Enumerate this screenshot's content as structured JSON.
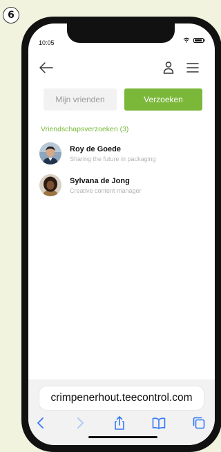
{
  "step": {
    "number": "6"
  },
  "status_bar": {
    "time": "10:05",
    "icons": [
      "wifi-icon",
      "battery-icon"
    ]
  },
  "nav": {
    "icons": [
      "back-arrow-icon",
      "user-icon",
      "hamburger-menu-icon"
    ]
  },
  "tabs": [
    {
      "label": "Mijn vrienden",
      "active": false
    },
    {
      "label": "Verzoeken",
      "active": true
    }
  ],
  "requests": {
    "title": "Vriendschapsverzoeken (3)",
    "items": [
      {
        "name": "Roy de Goede",
        "subtitle": "Sharing the future in packaging"
      },
      {
        "name": "Sylvana de Jong",
        "subtitle": "Creative content manager"
      }
    ]
  },
  "browser": {
    "url": "crimpenerhout.teecontrol.com",
    "toolbar_icons": [
      "back-icon",
      "forward-icon",
      "share-icon",
      "bookmarks-icon",
      "tabs-icon"
    ]
  },
  "colors": {
    "accent": "#7bb83a",
    "background": "#f1f3df"
  }
}
